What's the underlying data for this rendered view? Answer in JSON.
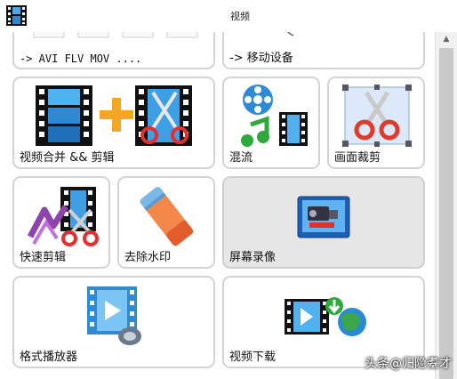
{
  "window": {
    "title": "视频"
  },
  "tiles": {
    "convert": {
      "label": "-> AVI FLV MOV ...."
    },
    "mobile": {
      "label": "-> 移动设备"
    },
    "merge": {
      "label": "视频合并 && 剪辑"
    },
    "mix": {
      "label": "混流"
    },
    "crop": {
      "label": "画面裁剪"
    },
    "fastcut": {
      "label": "快速剪辑"
    },
    "watermark": {
      "label": "去除水印"
    },
    "record": {
      "label": "屏幕录像"
    },
    "player": {
      "label": "格式播放器"
    },
    "download": {
      "label": "视频下载"
    }
  },
  "overlay": {
    "watermark": "头条@归隐耋才"
  }
}
